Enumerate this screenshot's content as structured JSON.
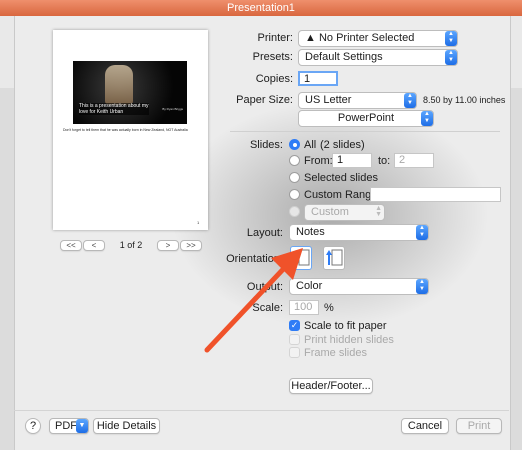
{
  "window": {
    "title": "Presentation1"
  },
  "preview": {
    "caption": "This is a presentation about my love for Keith Urban",
    "credit": "By Ryan Briggs",
    "notes_text": "Don't forget to tell them that he was actually born in New Zealand, NOT Australia",
    "page_number": "1",
    "nav": {
      "first": "<<",
      "prev": "<",
      "page_label": "1 of 2",
      "next": ">",
      "last": ">>"
    }
  },
  "printer": {
    "label": "Printer:",
    "value": "No Printer Selected"
  },
  "presets": {
    "label": "Presets:",
    "value": "Default Settings"
  },
  "copies": {
    "label": "Copies:",
    "value": "1"
  },
  "paper_size": {
    "label": "Paper Size:",
    "value": "US Letter",
    "dimensions": "8.50 by 11.00 inches"
  },
  "section": {
    "value": "PowerPoint"
  },
  "slides": {
    "label": "Slides:",
    "all_label": "All",
    "all_detail": "(2 slides)",
    "from_label": "From:",
    "from_value": "1",
    "to_label": "to:",
    "to_value": "2",
    "selected_label": "Selected slides",
    "custom_range_label": "Custom Range:",
    "custom_shows": "Custom Shows"
  },
  "layout": {
    "label": "Layout:",
    "value": "Notes"
  },
  "orientation": {
    "label": "Orientation:"
  },
  "output": {
    "label": "Output:",
    "value": "Color"
  },
  "scale": {
    "label": "Scale:",
    "value": "100",
    "unit": "%"
  },
  "options": {
    "scale_to_fit": "Scale to fit paper",
    "print_hidden": "Print hidden slides",
    "frame_slides": "Frame slides"
  },
  "header_footer_button": "Header/Footer...",
  "footer": {
    "help": "?",
    "pdf": "PDF",
    "hide_details": "Hide Details",
    "cancel": "Cancel",
    "print": "Print"
  },
  "colors": {
    "accent": "#2e7cf6",
    "arrow": "#f0522a",
    "titlebar": "#e07a52"
  }
}
